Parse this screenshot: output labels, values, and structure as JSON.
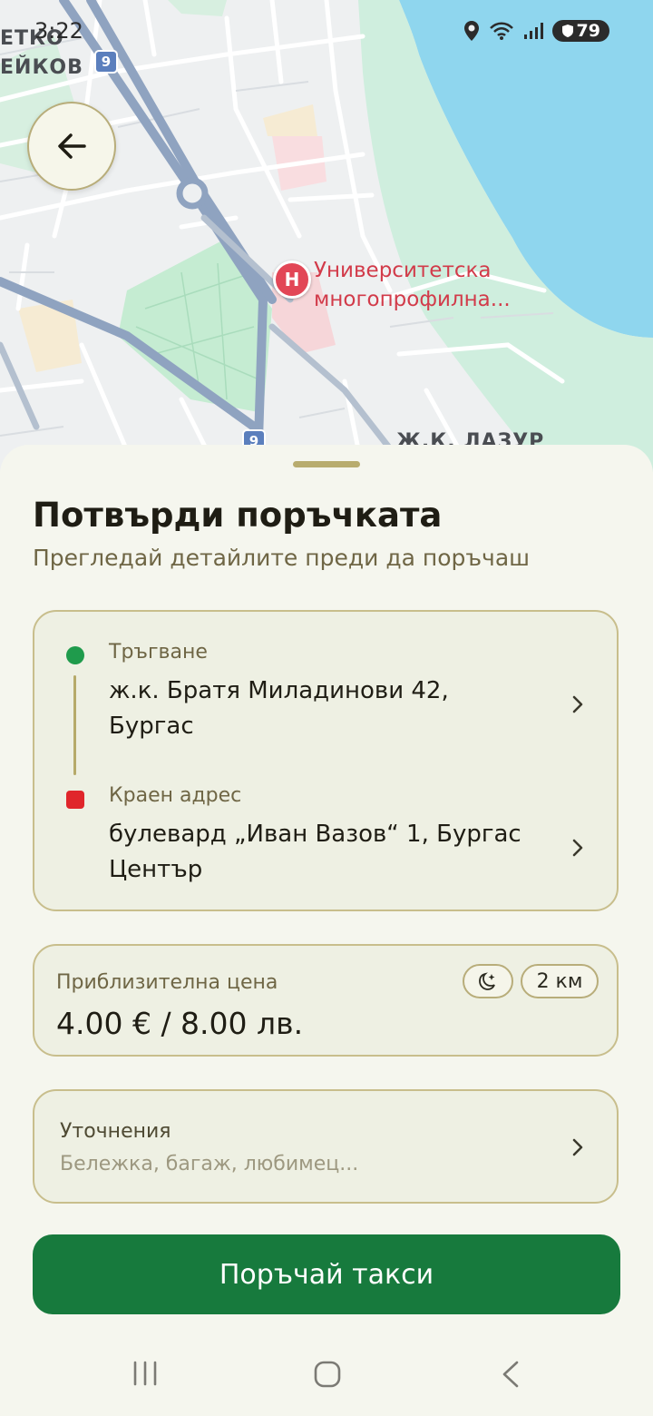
{
  "status_bar": {
    "time": "3:22",
    "battery": "79"
  },
  "map": {
    "labels": {
      "district_top_line1": "ЕТКО",
      "district_top_line2": "ЕЙКОВ",
      "road_badge_top": "9",
      "road_badge_bottom": "9",
      "district_bottom": "Ж.К. ЛАЗУР"
    },
    "poi": {
      "pin": "H",
      "line1": "Университетска",
      "line2": "многопрофилна..."
    }
  },
  "sheet": {
    "title": "Потвърди поръчката",
    "subtitle": "Прегледай детайлите преди да поръчаш",
    "route": {
      "pickup_label": "Тръгване",
      "pickup_line1": "ж.к. Братя Миладинови 42,",
      "pickup_line2": "Бургас",
      "dropoff_label": "Краен адрес",
      "dropoff_line1": "булевард „Иван Вазов“ 1, Бургас",
      "dropoff_line2": "Център"
    },
    "price": {
      "label": "Приблизителна цена",
      "value": "4.00 € / 8.00 лв.",
      "distance": "2 км",
      "night_icon": "moon-star-icon"
    },
    "notes": {
      "label": "Уточнения",
      "placeholder": "Бележка, багаж, любимец..."
    },
    "order_button": "Поръчай такси"
  },
  "colors": {
    "primary": "#177a3d",
    "accent": "#b8ac6e",
    "pickup": "#1f9b4c",
    "dropoff": "#e0262b"
  }
}
